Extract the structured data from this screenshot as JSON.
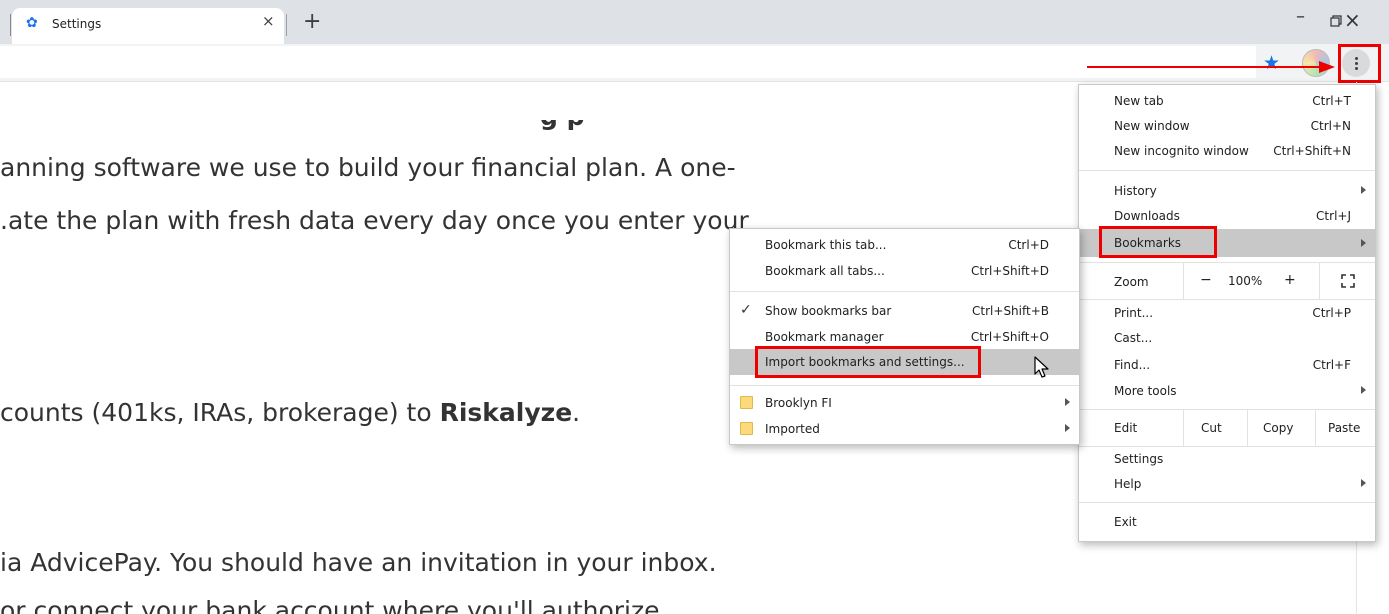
{
  "tab": {
    "title": "Settings",
    "close": "×",
    "new_tab": "+"
  },
  "window": {
    "minimize": "–",
    "close": "×"
  },
  "page_lines": [
    "anning software we use to build your financial plan. A one-",
    ".ate the plan with fresh data every day once you enter your",
    "ia AdvicePay. You should have an invitation in your inbox.",
    "or connect your bank account where you'll authorize"
  ],
  "partial_line": "g   p",
  "accounts_line": {
    "text": "counts (401ks, IRAs, brokerage) to ",
    "bold": "Riskalyze",
    "end": "."
  },
  "main_menu": {
    "new_tab": {
      "label": "New tab",
      "shortcut": "Ctrl+T"
    },
    "new_window": {
      "label": "New window",
      "shortcut": "Ctrl+N"
    },
    "new_incognito": {
      "label": "New incognito window",
      "shortcut": "Ctrl+Shift+N"
    },
    "history": {
      "label": "History"
    },
    "downloads": {
      "label": "Downloads",
      "shortcut": "Ctrl+J"
    },
    "bookmarks": {
      "label": "Bookmarks"
    },
    "zoom": {
      "label": "Zoom",
      "minus": "−",
      "level": "100%",
      "plus": "+"
    },
    "print": {
      "label": "Print...",
      "shortcut": "Ctrl+P"
    },
    "cast": {
      "label": "Cast..."
    },
    "find": {
      "label": "Find...",
      "shortcut": "Ctrl+F"
    },
    "more_tools": {
      "label": "More tools"
    },
    "edit": {
      "label": "Edit",
      "cut": "Cut",
      "copy": "Copy",
      "paste": "Paste"
    },
    "settings": {
      "label": "Settings"
    },
    "help": {
      "label": "Help"
    },
    "exit": {
      "label": "Exit"
    }
  },
  "bookmarks_menu": {
    "bookmark_tab": {
      "label": "Bookmark this tab...",
      "shortcut": "Ctrl+D"
    },
    "bookmark_all": {
      "label": "Bookmark all tabs...",
      "shortcut": "Ctrl+Shift+D"
    },
    "show_bar": {
      "label": "Show bookmarks bar",
      "shortcut": "Ctrl+Shift+B",
      "check": "✓"
    },
    "manager": {
      "label": "Bookmark manager",
      "shortcut": "Ctrl+Shift+O"
    },
    "import": {
      "label": "Import bookmarks and settings..."
    },
    "folders": [
      {
        "label": "Brooklyn FI"
      },
      {
        "label": "Imported"
      }
    ]
  },
  "colors": {
    "highlight": "#e00000",
    "menu_hover": "#c8c8c8",
    "accent": "#1a73e8"
  }
}
